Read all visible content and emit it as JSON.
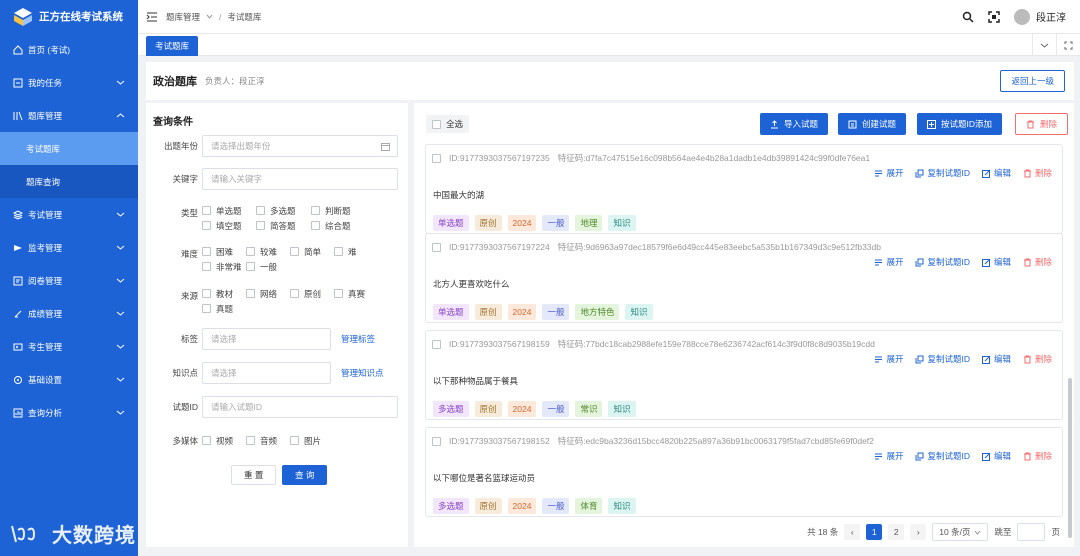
{
  "app": {
    "title": "正方在线考试系统"
  },
  "sidebar": {
    "items": [
      {
        "label": "首页 (考试)",
        "icon": "home-icon"
      },
      {
        "label": "我的任务",
        "icon": "task-icon"
      },
      {
        "label": "题库管理",
        "icon": "library-icon"
      },
      {
        "label": "考试管理",
        "icon": "exam-icon"
      },
      {
        "label": "监考管理",
        "icon": "proctor-icon"
      },
      {
        "label": "阅卷管理",
        "icon": "grading-icon"
      },
      {
        "label": "成绩管理",
        "icon": "score-icon"
      },
      {
        "label": "考生管理",
        "icon": "student-icon"
      },
      {
        "label": "基础设置",
        "icon": "settings-icon"
      },
      {
        "label": "查询分析",
        "icon": "analysis-icon"
      }
    ],
    "sub_items": [
      "考试题库",
      "题库查询"
    ],
    "watermark": "大数跨境"
  },
  "topbar": {
    "breadcrumb": [
      "题库管理",
      "考试题库"
    ],
    "user": "段正淳"
  },
  "tabs": {
    "active": "考试题库"
  },
  "header": {
    "title": "政治题库",
    "owner": "负责人：段正淳",
    "back_label": "返回上一级"
  },
  "query": {
    "title": "查询条件",
    "year": {
      "label": "出题年份",
      "placeholder": "请选择出题年份"
    },
    "keyword": {
      "label": "关键字",
      "placeholder": "请输入关键字"
    },
    "type": {
      "label": "类型",
      "options": [
        "单选题",
        "多选题",
        "判断题",
        "填空题",
        "简答题",
        "综合题"
      ]
    },
    "difficulty": {
      "label": "难度",
      "options": [
        "困难",
        "较难",
        "简单",
        "难",
        "非常难",
        "一般"
      ]
    },
    "source": {
      "label": "来源",
      "options": [
        "教材",
        "网络",
        "原创",
        "真赛",
        "真题"
      ]
    },
    "tags": {
      "label": "标签",
      "placeholder": "请选择",
      "manage": "管理标签"
    },
    "knowledge": {
      "label": "知识点",
      "placeholder": "请选择",
      "manage": "管理知识点"
    },
    "qid": {
      "label": "试题ID",
      "placeholder": "请输入试题ID"
    },
    "media": {
      "label": "多媒体",
      "options": [
        "视频",
        "音频",
        "图片"
      ]
    },
    "reset": "重 置",
    "search": "查 询"
  },
  "list": {
    "select_all": "全选",
    "actions": {
      "import": "导入试题",
      "create": "创建试题",
      "add_by_id": "按试题ID添加",
      "delete": "删除"
    },
    "row_actions": {
      "expand": "展开",
      "copy": "复制试题ID",
      "edit": "编辑",
      "delete": "删除"
    },
    "questions": [
      {
        "id": "ID:9177393037567197235",
        "code": "特征码:d7fa7c47515e16c098b564ae4e4b28a1dadb1e4db39891424c99f0dfe76ea1",
        "text": "中国最大的湖",
        "tags": [
          "单选题",
          "原创",
          "2024",
          "一般",
          "地理",
          "知识"
        ]
      },
      {
        "id": "ID:9177393037567197224",
        "code": "特征码:9d6963a97dec18579f6e6d49cc445e83eebc5a535b1b167349d3c9e512fb33db",
        "text": "北方人更喜欢吃什么",
        "tags": [
          "单选题",
          "原创",
          "2024",
          "一般",
          "地方特色",
          "知识"
        ]
      },
      {
        "id": "ID:9177393037567198159",
        "code": "特征码:77bdc18cab2988efe159e788cce78e6236742acf614c3f9d0f8c8d9035b19cdd",
        "text": "以下那种物品属于餐具",
        "tags": [
          "多选题",
          "原创",
          "2024",
          "一般",
          "常识",
          "知识"
        ]
      },
      {
        "id": "ID:9177393037567198152",
        "code": "特征码:edc9ba3236d15bcc4820b225a897a36b91bc0063179f5fad7cbd85fe69f0def2",
        "text": "以下哪位是著名篮球运动员",
        "tags": [
          "多选题",
          "原创",
          "2024",
          "一般",
          "体育",
          "知识"
        ]
      }
    ],
    "tag_colors": [
      {
        "bg": "#f1e6fb",
        "fg": "#8b43c9"
      },
      {
        "bg": "#f7ecdc",
        "fg": "#a0702a"
      },
      {
        "bg": "#fde9dc",
        "fg": "#d9652a"
      },
      {
        "bg": "#e4e8fb",
        "fg": "#4a5dc9"
      },
      {
        "bg": "#e5f4dc",
        "fg": "#4f8a2a"
      },
      {
        "bg": "#dcf4f2",
        "fg": "#2a8a80"
      }
    ]
  },
  "pagination": {
    "total": "共 18 条",
    "pages": [
      "1",
      "2"
    ],
    "current": "1",
    "page_size": "10 条/页",
    "jump_label": "跳至",
    "page_suffix": "页"
  },
  "colors": {
    "primary": "#1e63d6",
    "danger": "#f56c6c",
    "sidebar": "#1e63d6",
    "sidebar_active": "#5b9bf0"
  }
}
